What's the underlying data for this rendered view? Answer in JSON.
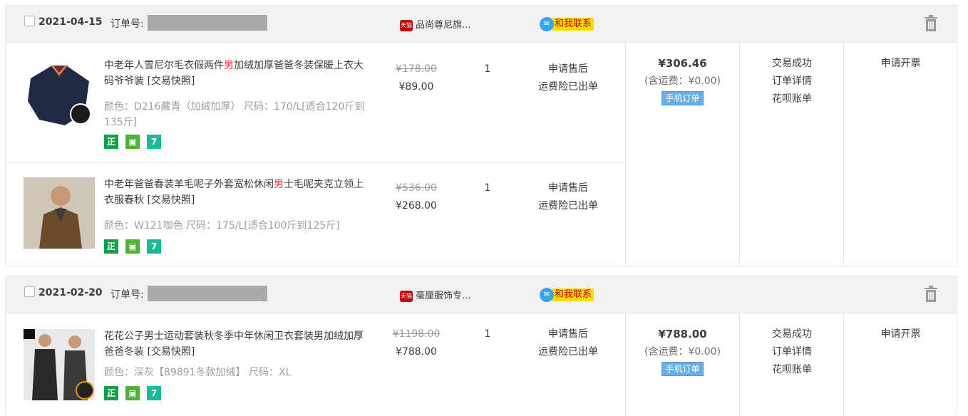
{
  "orders": [
    {
      "date": "2021-04-15",
      "order_no_label": "订单号:",
      "shop_badge": "天猫",
      "shop_name": "品尚尊尼旗...",
      "contact_label": "和我联系",
      "items": [
        {
          "title_before": "中老年人雪尼尔毛衣假两件",
          "title_highlight": "男",
          "title_after": "加绒加厚爸爸冬装保暖上衣大码爷爷装 [交易快照]",
          "attrs": "颜色：D216藏青（加绒加厚）    尺码：170/L[适合120斤到135斤]",
          "badges": [
            "正",
            "▣",
            "7"
          ],
          "price_original": "¥178.00",
          "price_now": "¥89.00",
          "qty": "1",
          "service_1": "申请售后",
          "service_2": "运费险已出单"
        },
        {
          "title_before": "中老年爸爸春装羊毛呢子外套宽松休闲",
          "title_highlight": "男",
          "title_after": "士毛呢夹克立领上衣服春秋 [交易快照]",
          "attrs": "颜色：W121咖色   尺码：175/L[适合100斤到125斤]",
          "badges": [
            "正",
            "▣",
            "7"
          ],
          "price_original": "¥536.00",
          "price_now": "¥268.00",
          "qty": "1",
          "service_1": "申请售后",
          "service_2": "运费险已出单"
        }
      ],
      "total": "¥306.46",
      "shipping": "(含运费：¥0.00)",
      "mobile_tag": "手机订单",
      "status": "交易成功",
      "detail_link": "订单详情",
      "huabei_link": "花呗账单",
      "invoice": "申请开票"
    },
    {
      "date": "2021-02-20",
      "order_no_label": "订单号:",
      "shop_badge": "天猫",
      "shop_name": "毫厘服饰专...",
      "contact_label": "和我联系",
      "items": [
        {
          "title_before": "花花公子男士运动套装秋冬季中年休闲卫衣套装男加绒加厚爸爸冬装 [交易快照]",
          "title_highlight": "",
          "title_after": "",
          "attrs": "颜色：深灰【89891冬款加绒】   尺码：XL",
          "badges": [
            "正",
            "▣",
            "7"
          ],
          "price_original": "¥1198.00",
          "price_now": "¥788.00",
          "qty": "1",
          "service_1": "申请售后",
          "service_2": "运费险已出单"
        }
      ],
      "total": "¥788.00",
      "shipping": "(含运费：¥0.00)",
      "mobile_tag": "手机订单",
      "status": "交易成功",
      "detail_link": "订单详情",
      "huabei_link": "花呗账单",
      "invoice": "申请开票"
    }
  ],
  "colors": {
    "header_bg": "#f1f1f1",
    "highlight": "#e4393c",
    "muted": "#9c9c9c",
    "mobile_tag": "#66b0e6",
    "contact_bg": "#ffdd00"
  }
}
